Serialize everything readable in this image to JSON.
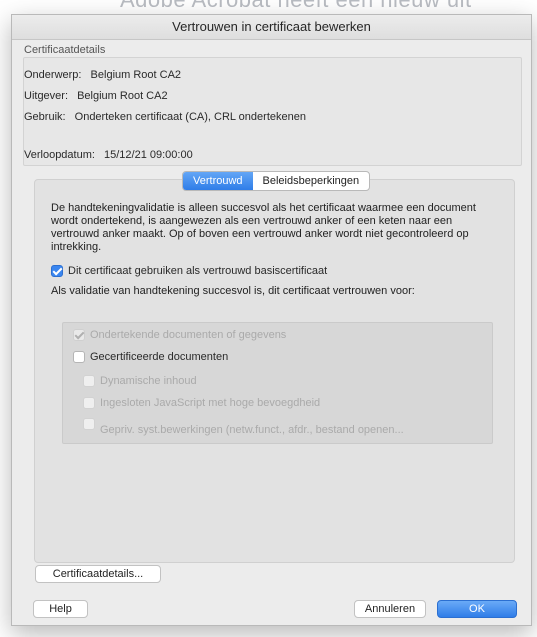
{
  "background": {
    "text": "Adobe Acrobat heeft een nieuw uit"
  },
  "dialog": {
    "title": "Vertrouwen in certificaat bewerken",
    "section_title": "Certificaatdetails",
    "subject": {
      "label": "Onderwerp:",
      "value": "Belgium Root CA2"
    },
    "issuer": {
      "label": "Uitgever:",
      "value": "Belgium Root CA2"
    },
    "usage": {
      "label": "Gebruik:",
      "value": "Onderteken certificaat (CA), CRL ondertekenen"
    },
    "expiry": {
      "label": "Verloopdatum:",
      "value": "15/12/21 09:00:00"
    },
    "tabs": [
      {
        "label": "Vertrouwd",
        "active": true
      },
      {
        "label": "Beleidsbeperkingen",
        "active": false
      }
    ],
    "trusted_tab": {
      "description": "De handtekeningvalidatie is alleen succesvol als het certificaat waarmee een document wordt ondertekend, is aangewezen als een vertrouwd anker of een keten naar een vertrouwd anker maakt. Op of boven een vertrouwd anker wordt niet gecontroleerd op intrekking.",
      "root_checkbox": {
        "label": "Dit certificaat gebruiken als vertrouwd basiscertificaat",
        "checked": true
      },
      "validation_intro": "Als validatie van handtekening succesvol is, dit certificaat vertrouwen voor:",
      "options": [
        {
          "label": "Ondertekende documenten of gegevens",
          "checked": true,
          "enabled": false
        },
        {
          "label": "Gecertificeerde documenten",
          "checked": false,
          "enabled": true
        },
        {
          "label": "Dynamische inhoud",
          "checked": false,
          "enabled": false
        },
        {
          "label": "Ingesloten JavaScript met hoge bevoegdheid",
          "checked": false,
          "enabled": false
        },
        {
          "label": "Gepriv. syst.bewerkingen (netw.funct., afdr., bestand openen...",
          "checked": false,
          "enabled": false
        }
      ]
    },
    "buttons": {
      "details": "Certificaatdetails...",
      "help": "Help",
      "cancel": "Annuleren",
      "ok": "OK"
    }
  }
}
